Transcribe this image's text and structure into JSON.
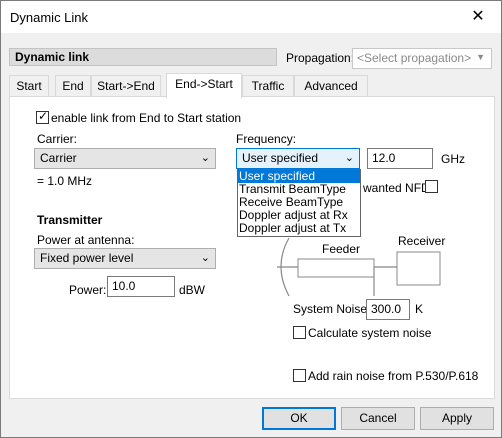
{
  "window": {
    "title": "Dynamic Link",
    "close_glyph": "✕"
  },
  "header": {
    "section_label": "Dynamic link",
    "propagation_label": "Propagation:",
    "propagation_placeholder": "<Select propagation>"
  },
  "tabs": [
    {
      "label": "Start"
    },
    {
      "label": "End"
    },
    {
      "label": "Start->End"
    },
    {
      "label": "End->Start",
      "active": true
    },
    {
      "label": "Traffic"
    },
    {
      "label": "Advanced"
    }
  ],
  "panel": {
    "enable_link_label": "enable link from End to Start station",
    "enable_link_checked": true,
    "carrier_label": "Carrier:",
    "carrier_value": "Carrier",
    "carrier_info": "= 1.0 MHz",
    "frequency_label": "Frequency:",
    "frequency_mode": "User specified",
    "frequency_value": "12.0",
    "frequency_unit": "GHz",
    "frequency_options": [
      "User specified",
      "Transmit BeamType",
      "Receive BeamType",
      "Doppler adjust at Rx",
      "Doppler adjust at Tx"
    ],
    "wanted_nfd_label": "wanted NFD",
    "transmitter_heading": "Transmitter",
    "power_at_antenna_label": "Power at antenna:",
    "power_mode": "Fixed power level",
    "power_label": "Power:",
    "power_value": "10.0",
    "power_unit": "dBW",
    "feeder_label": "Feeder",
    "receiver_label": "Receiver",
    "system_noise_label": "System Noise:",
    "system_noise_value": "300.0",
    "system_noise_unit": "K",
    "calc_noise_label": "Calculate system noise",
    "rain_noise_label": "Add rain noise from P.530/P.618"
  },
  "buttons": {
    "ok": "OK",
    "cancel": "Cancel",
    "apply": "Apply"
  },
  "colors": {
    "accent": "#0078d7",
    "selection": "#0078d7"
  }
}
